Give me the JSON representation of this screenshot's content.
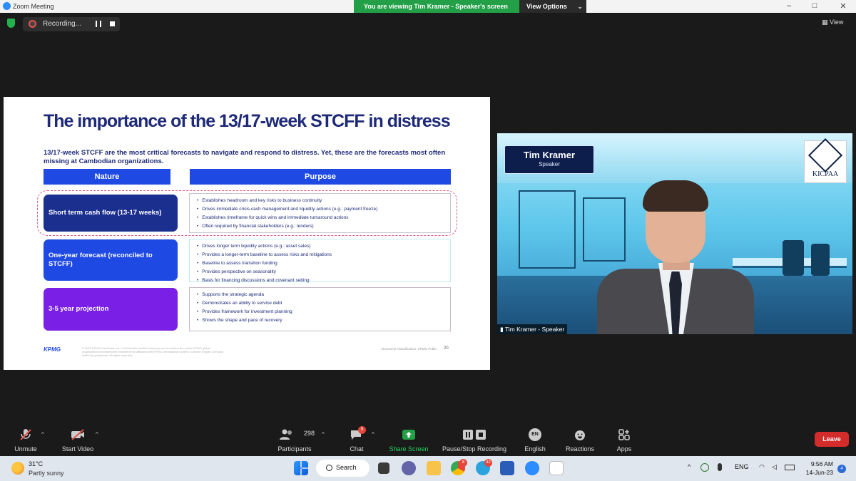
{
  "window": {
    "app_name": "Zoom Meeting",
    "share_banner": "You are viewing Tim Kramer - Speaker's screen",
    "view_options": "View Options"
  },
  "meeting_bar": {
    "recording_label": "Recording...",
    "view_label": "View"
  },
  "slide": {
    "title": "The importance of the 13/17-week STCFF in distress",
    "subtitle": "13/17-week STCFF are the most critical forecasts to navigate and respond to distress. Yet, these are the forecasts most often missing at Cambodian organizations.",
    "col_nature": "Nature",
    "col_purpose": "Purpose",
    "rows": [
      {
        "nature": "Short term cash flow (13-17 weeks)",
        "color": "#1b2f8f",
        "purpose": [
          "Establishes headroom and key risks to business continuity",
          "Drives immediate crisis cash management and liquidity actions (e.g.: payment freeze)",
          "Establishes timeframe for quick wins and immediate turnaround actions",
          "Often required by financial stakeholders (e.g.: lenders)"
        ]
      },
      {
        "nature": "One-year forecast (reconciled to STCFF)",
        "color": "#1e49e2",
        "purpose": [
          "Drives longer term liquidity actions (e.g.: asset sales)",
          "Provides a longer-term baseline to assess risks and mitigations",
          "Baseline to assess transition funding",
          "Provides perspective on seasonality",
          "Basis for financing discussions and covenant setting"
        ]
      },
      {
        "nature": "3-5 year projection",
        "color": "#7a1fe6",
        "purpose": [
          "Supports the strategic agenda",
          "Demonstrates an ability to service debt",
          "Provides framework for investment planning",
          "Shows the shape and pace of recovery"
        ]
      }
    ],
    "logo": "KPMG",
    "footer": "© 2023 KPMG Cambodia Ltd., a Cambodian limited company and a member firm of the KPMG global organization of independent member firms affiliated with KPMG International Limited, a private English company limited by guarantee. All rights reserved.",
    "doc_label": "Document Classification: KPMG Public",
    "page_number": "20"
  },
  "video": {
    "name": "Tim Kramer",
    "role": "Speaker",
    "logo_text": "KICPAA",
    "participant_label": "Tim Kramer - Speaker"
  },
  "toolbar": {
    "unmute": "Unmute",
    "start_video": "Start Video",
    "participants": "Participants",
    "participant_count": "298",
    "chat": "Chat",
    "chat_badge": "9",
    "share_screen": "Share Screen",
    "pause_stop": "Pause/Stop Recording",
    "language_code": "EN",
    "language": "English",
    "reactions": "Reactions",
    "apps": "Apps",
    "leave": "Leave"
  },
  "taskbar": {
    "temperature": "31°C",
    "weather": "Partly sunny",
    "search": "Search",
    "chrome_badge": "8",
    "telegram_badge": "32",
    "lang": "ENG",
    "time": "9:56 AM",
    "date": "14-Jun-23",
    "notif": "4"
  }
}
